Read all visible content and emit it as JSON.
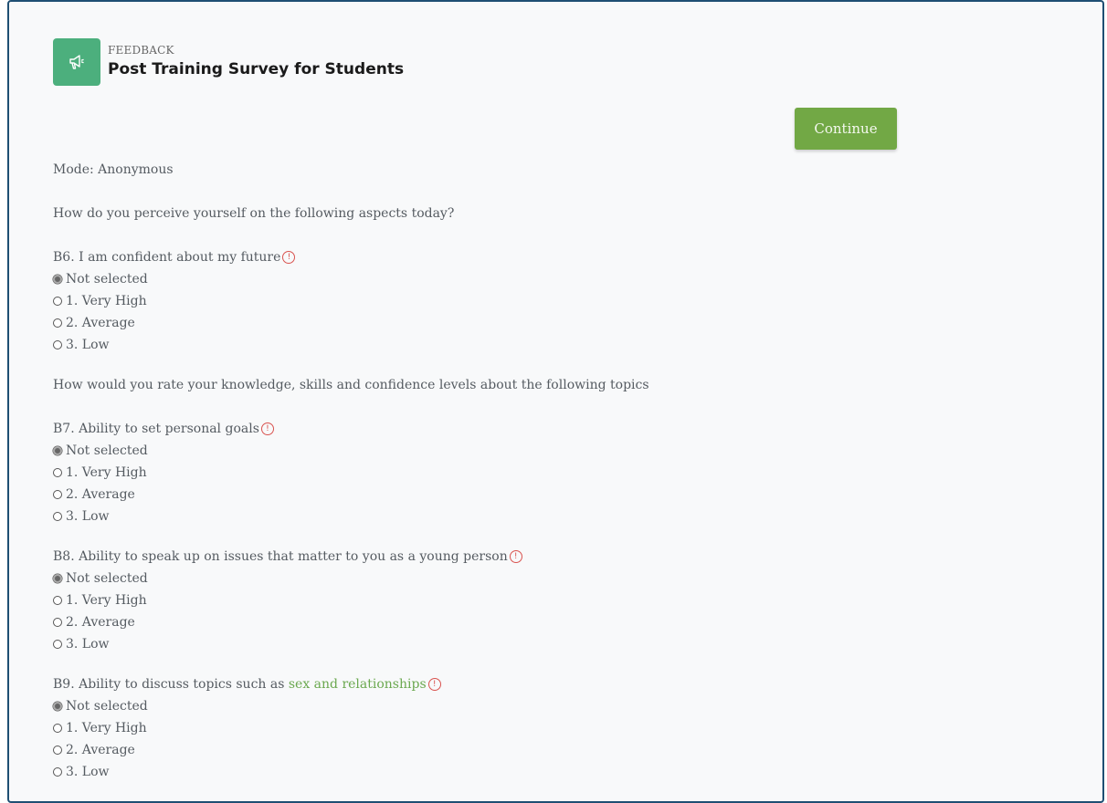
{
  "header": {
    "eyebrow": "FEEDBACK",
    "title": "Post Training Survey for Students"
  },
  "continue_label": "Continue",
  "mode_text": "Mode: Anonymous",
  "section1_intro": "How do you perceive yourself on the following aspects today?",
  "section2_intro": "How would you rate your knowledge, skills and confidence levels about the following topics",
  "options": [
    "Not selected",
    "1. Very High",
    "2. Average",
    "3. Low"
  ],
  "questions": {
    "b6": {
      "label": "B6. I am confident about my future"
    },
    "b7": {
      "label": "B7. Ability to set personal goals"
    },
    "b8": {
      "label": "B8. Ability to speak up on issues that matter to you as a young person"
    },
    "b9": {
      "label_prefix": "B9. Ability to discuss topics such as ",
      "label_highlight": "sex and relationships"
    }
  },
  "warning_glyph": "!",
  "colors": {
    "brand": "#4caf7d",
    "button": "#72a845",
    "highlight": "#6aa84f",
    "warning": "#d9534f",
    "frame_border": "#1f4f73"
  },
  "icons": {
    "logo": "megaphone-icon",
    "required": "exclamation-circle-icon"
  }
}
